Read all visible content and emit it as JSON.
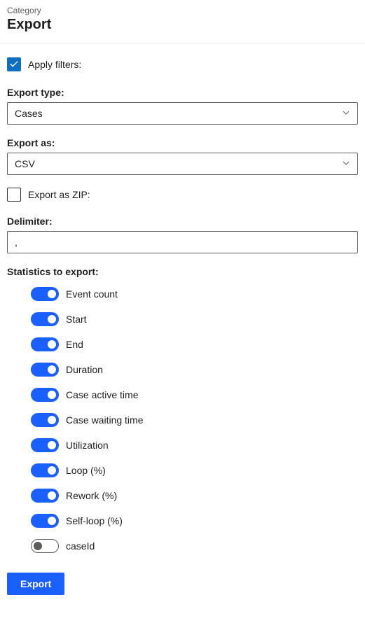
{
  "header": {
    "category": "Category",
    "title": "Export"
  },
  "applyFilters": {
    "label": "Apply filters:",
    "checked": true
  },
  "exportType": {
    "label": "Export type:",
    "value": "Cases"
  },
  "exportAs": {
    "label": "Export as:",
    "value": "CSV"
  },
  "exportZip": {
    "label": "Export as ZIP:",
    "checked": false
  },
  "delimiter": {
    "label": "Delimiter:",
    "value": ","
  },
  "statistics": {
    "label": "Statistics to export:",
    "items": [
      {
        "label": "Event count",
        "on": true
      },
      {
        "label": "Start",
        "on": true
      },
      {
        "label": "End",
        "on": true
      },
      {
        "label": "Duration",
        "on": true
      },
      {
        "label": "Case active time",
        "on": true
      },
      {
        "label": "Case waiting time",
        "on": true
      },
      {
        "label": "Utilization",
        "on": true
      },
      {
        "label": "Loop (%)",
        "on": true
      },
      {
        "label": "Rework (%)",
        "on": true
      },
      {
        "label": "Self-loop (%)",
        "on": true
      },
      {
        "label": "caseId",
        "on": false
      }
    ]
  },
  "exportButton": {
    "label": "Export"
  }
}
